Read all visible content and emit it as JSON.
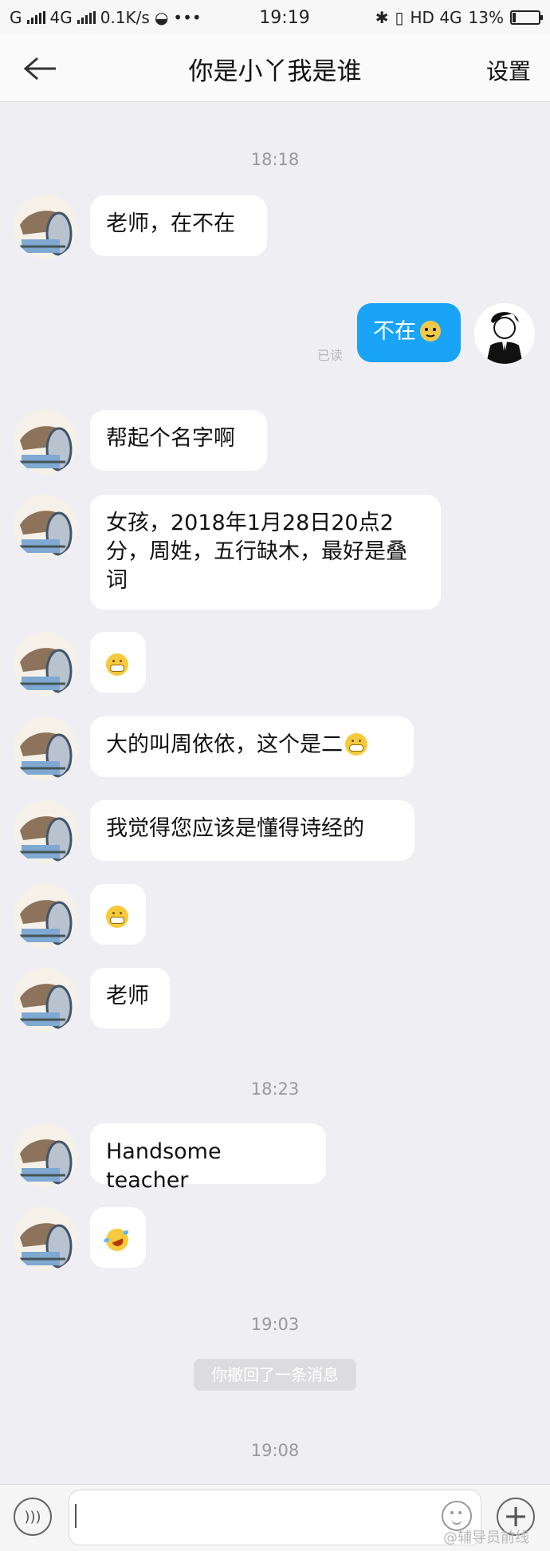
{
  "status_bar": {
    "carrier": "G",
    "network": "4G",
    "speed": "0.1K/s",
    "time": "19:19",
    "right_network": "HD 4G",
    "battery": "13%",
    "battery_level_percent": 13
  },
  "header": {
    "title": "你是小丫我是谁",
    "settings_label": "设置"
  },
  "timestamps": [
    "18:18",
    "18:23",
    "19:03",
    "19:08"
  ],
  "messages": [
    {
      "text": "老师，在不在"
    },
    {
      "text": "不在",
      "emoji": "doge-emoji",
      "side": "right"
    },
    {
      "text": "帮起个名字啊"
    },
    {
      "text": "女孩，2018年1月28日20点2分，周姓，五行缺木，最好是叠词"
    },
    {
      "text": "",
      "emoji": "grin-emoji"
    },
    {
      "text": "大的叫周依依，这个是二",
      "emoji": "grin-emoji"
    },
    {
      "text": "我觉得您应该是懂得诗经的"
    },
    {
      "text": "",
      "emoji": "grin-emoji"
    },
    {
      "text": "老师"
    },
    {
      "text": "Handsome teacher"
    },
    {
      "text": "",
      "emoji": "tears-of-joy-emoji"
    }
  ],
  "read_receipt": "已读",
  "system_message": "你撤回了一条消息",
  "watermark": "@辅导员前线",
  "input": {
    "placeholder": ""
  }
}
